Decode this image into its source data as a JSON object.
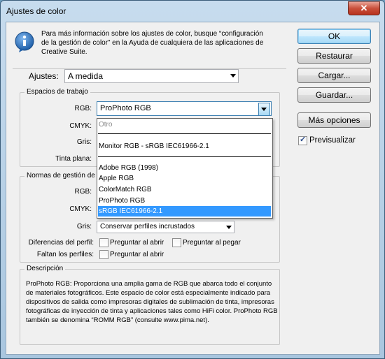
{
  "window": {
    "title": "Ajustes de color",
    "close_glyph": "✕"
  },
  "info": {
    "icon": "info-icon",
    "text": "Para más información sobre los ajustes de color, busque “configuración de la gestión de color” en la Ayuda de cualquiera de las aplicaciones de Creative Suite."
  },
  "buttons": {
    "ok": "OK",
    "restaurar": "Restaurar",
    "cargar": "Cargar...",
    "guardar": "Guardar...",
    "mas_opciones": "Más opciones"
  },
  "preview": {
    "label": "Previsualizar",
    "checked": true
  },
  "settings": {
    "label": "Ajustes:",
    "value": "A medida"
  },
  "workspaces": {
    "legend": "Espacios de trabajo",
    "rgb_label": "RGB:",
    "rgb_value": "ProPhoto RGB",
    "cmyk_label": "CMYK:",
    "gris_label": "Gris:",
    "tinta_label": "Tinta plana:"
  },
  "dropdown_items": {
    "otro": "Otro",
    "monitor": "Monitor RGB - sRGB IEC61966-2.1",
    "adobe": "Adobe RGB (1998)",
    "apple": "Apple RGB",
    "colormatch": "ColorMatch RGB",
    "prophoto": "ProPhoto RGB",
    "srgb": "sRGB IEC61966-2.1"
  },
  "policies": {
    "legend": "Normas de gestión de color",
    "rgb_label": "RGB:",
    "cmyk_label": "CMYK:",
    "gris_label": "Gris:",
    "gris_value": "Conservar perfiles incrustados",
    "diff_label": "Diferencias del perfil:",
    "diff_open": "Preguntar al abrir",
    "diff_paste": "Preguntar al pegar",
    "missing_label": "Faltan los perfiles:",
    "missing_open": "Preguntar al abrir"
  },
  "description": {
    "legend": "Descripción",
    "text": "ProPhoto RGB: Proporciona una amplia gama de RGB que abarca todo el conjunto de materiales fotográficos. Este espacio de color está especialmente indicado para dispositivos de salida como impresoras digitales de sublimación de tinta, impresoras fotográficas de inyección de tinta y aplicaciones tales como HiFi color. ProPhoto RGB también se denomina “ROMM RGB” (consulte www.pima.net)."
  }
}
